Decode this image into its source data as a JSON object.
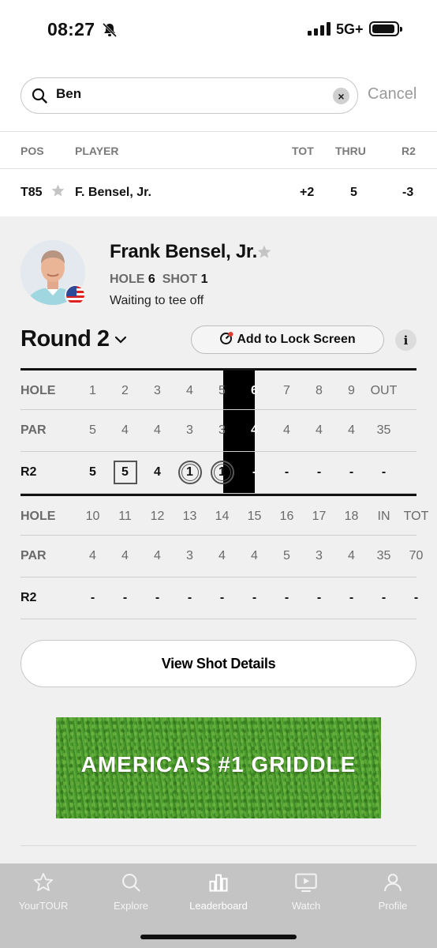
{
  "status": {
    "time": "08:27",
    "network": "5G+"
  },
  "search": {
    "query": "Ben",
    "cancel_label": "Cancel"
  },
  "leaderboard": {
    "headers": {
      "pos": "POS",
      "player": "PLAYER",
      "tot": "TOT",
      "thru": "THRU",
      "round": "R2"
    },
    "row": {
      "pos": "T85",
      "player": "F. Bensel, Jr.",
      "tot": "+2",
      "thru": "5",
      "round": "-3"
    }
  },
  "player": {
    "name": "Frank Bensel, Jr.",
    "hole_label": "HOLE",
    "hole_value": "6",
    "shot_label": "SHOT",
    "shot_value": "1",
    "status": "Waiting to tee off"
  },
  "round": {
    "title": "Round 2",
    "lock_label": "Add to Lock Screen",
    "info_label": "i"
  },
  "scorecard": {
    "front": {
      "holes": [
        "HOLE",
        "1",
        "2",
        "3",
        "4",
        "5",
        "6",
        "7",
        "8",
        "9",
        "OUT"
      ],
      "par": [
        "PAR",
        "5",
        "4",
        "4",
        "3",
        "3",
        "4",
        "4",
        "4",
        "4",
        "35"
      ],
      "score": [
        "R2",
        "5",
        "5",
        "4",
        "1",
        "1",
        "-",
        "-",
        "-",
        "-",
        "-"
      ]
    },
    "back": {
      "holes": [
        "HOLE",
        "10",
        "11",
        "12",
        "13",
        "14",
        "15",
        "16",
        "17",
        "18",
        "IN",
        "TOT"
      ],
      "par": [
        "PAR",
        "4",
        "4",
        "4",
        "3",
        "4",
        "4",
        "5",
        "3",
        "4",
        "35",
        "70"
      ],
      "score": [
        "R2",
        "-",
        "-",
        "-",
        "-",
        "-",
        "-",
        "-",
        "-",
        "-",
        "-",
        "-"
      ]
    }
  },
  "actions": {
    "view_shot_label": "View Shot Details"
  },
  "ad": {
    "text": "AMERICA'S #1 GRIDDLE"
  },
  "tabs": [
    {
      "label": "YourTOUR",
      "icon": "star-icon"
    },
    {
      "label": "Explore",
      "icon": "search-icon"
    },
    {
      "label": "Leaderboard",
      "icon": "bar-chart-icon"
    },
    {
      "label": "Watch",
      "icon": "play-screen-icon"
    },
    {
      "label": "Profile",
      "icon": "person-icon"
    }
  ]
}
